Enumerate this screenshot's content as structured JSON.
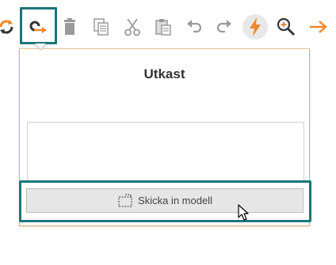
{
  "toolbar": {
    "items": [
      {
        "name": "refresh-icon"
      },
      {
        "name": "connect-arrow-icon"
      },
      {
        "name": "trash-icon"
      },
      {
        "name": "copy-icon"
      },
      {
        "name": "scissors-icon"
      },
      {
        "name": "paste-icon"
      },
      {
        "name": "undo-icon"
      },
      {
        "name": "redo-icon"
      },
      {
        "name": "lightning-icon"
      },
      {
        "name": "zoom-in-icon"
      },
      {
        "name": "arrow-right-icon"
      }
    ]
  },
  "panel": {
    "title": "Utkast",
    "submit_label": "Skicka in modell"
  },
  "colors": {
    "highlight": "#19767a",
    "accent": "#f0882a",
    "panel_border": "#e0a96a",
    "button_bg": "#e6e6e6"
  }
}
